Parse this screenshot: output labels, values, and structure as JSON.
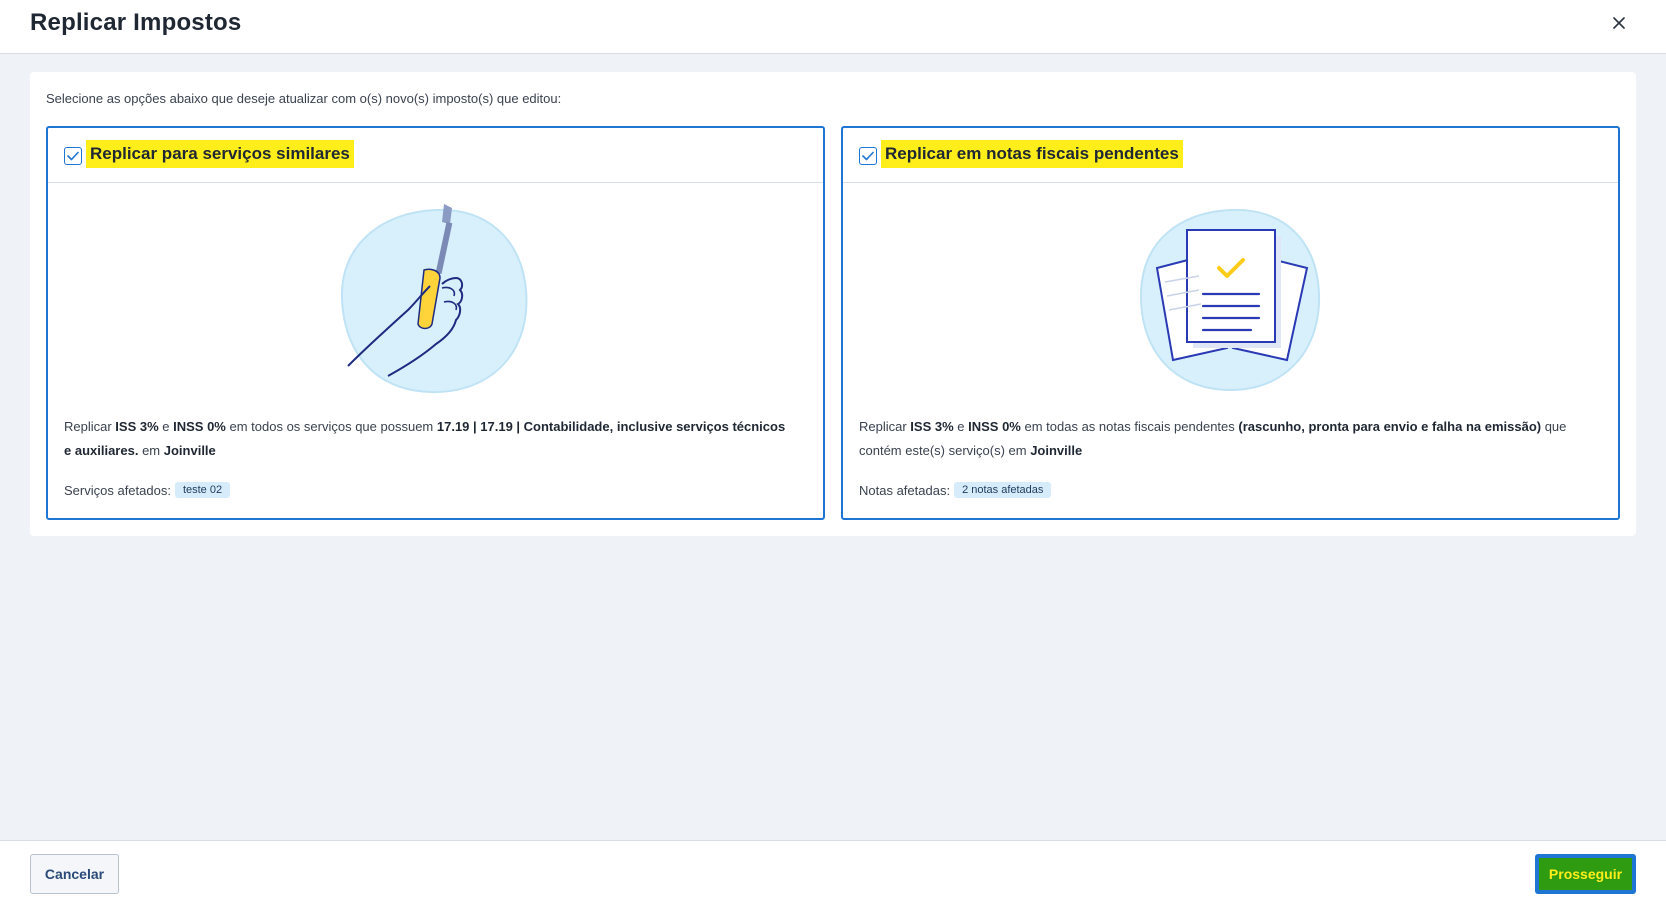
{
  "header": {
    "title": "Replicar Impostos",
    "close_icon": "close-icon"
  },
  "instruction": "Selecione as opções abaixo que deseje atualizar com o(s) novo(s) imposto(s) que editou:",
  "cards": [
    {
      "title": "Replicar para serviços similares",
      "checked": true,
      "illustration": "hand-screwdriver-illustration",
      "desc_prefix": "Replicar ",
      "iss": "ISS 3%",
      "and": " e ",
      "inss": "INSS 0%",
      "desc_middle": " em todos os serviços que possuem ",
      "service_code": "17.19 | 17.19 | Contabilidade, inclusive serviços técnicos e auxiliares.",
      "desc_in": " em ",
      "city": "Joinville",
      "affected_label": "Serviços afetados:",
      "affected_tag": "teste 02"
    },
    {
      "title": "Replicar em notas fiscais pendentes",
      "checked": true,
      "illustration": "documents-check-illustration",
      "desc_prefix": "Replicar ",
      "iss": "ISS 3%",
      "and": " e ",
      "inss": "INSS 0%",
      "desc_middle": " em todas as notas fiscais pendentes ",
      "status_list": "(rascunho, pronta para envio e falha na emissão)",
      "desc_after": " que contém este(s) serviço(s) em ",
      "city": "Joinville",
      "affected_label": "Notas afetadas:",
      "affected_tag": "2 notas afetadas"
    }
  ],
  "footer": {
    "cancel_label": "Cancelar",
    "proceed_label": "Prosseguir"
  },
  "colors": {
    "accent": "#1f75d4",
    "highlight": "#ffee1a",
    "proceed_bg": "#2e9b10",
    "tag_bg": "#d6ecfa"
  }
}
